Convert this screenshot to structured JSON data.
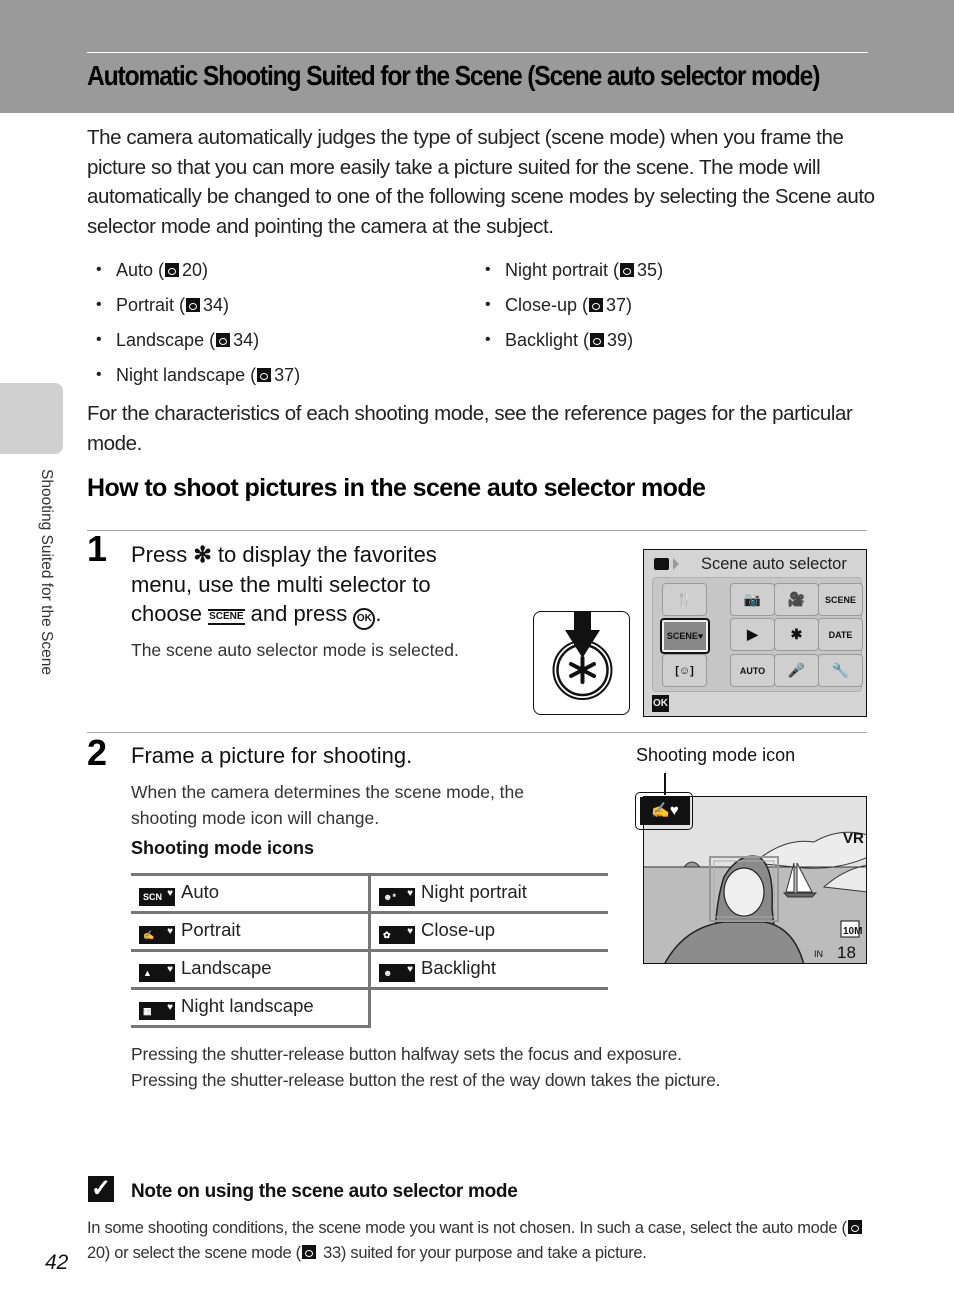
{
  "header": {
    "title": "Automatic Shooting Suited for the Scene (Scene auto selector mode)"
  },
  "intro": "The camera automatically judges the type of subject (scene mode) when you frame the picture so that you can more easily take a picture suited for the scene. The mode will automatically be changed to one of the following scene modes by selecting the Scene auto selector mode and pointing the camera at the subject.",
  "scene_modes_left": [
    {
      "label": "Auto (",
      "page": "20)"
    },
    {
      "label": "Portrait (",
      "page": "34)"
    },
    {
      "label": "Landscape (",
      "page": "34)"
    },
    {
      "label": "Night landscape (",
      "page": "37)"
    }
  ],
  "scene_modes_right": [
    {
      "label": "Night portrait (",
      "page": "35)"
    },
    {
      "label": "Close-up (",
      "page": "37)"
    },
    {
      "label": "Backlight (",
      "page": "39)"
    }
  ],
  "characteristics": "For the characteristics of each shooting mode, see the reference pages for the particular mode.",
  "section_title": "How to shoot pictures in the scene auto selector mode",
  "side_label": "Shooting Suited for the Scene",
  "step1": {
    "number": "1",
    "line1_a": "Press ",
    "line1_sym": "✻",
    "line1_b": " to display the favorites",
    "line2": "menu, use the multi selector to",
    "line3_a": "choose ",
    "line3_icon": "SCENE",
    "line3_b": " and press ",
    "line3_ok": "OK",
    "line3_c": ".",
    "sub": "The scene auto selector mode is selected."
  },
  "lcd": {
    "title": "Scene auto selector",
    "ok": "OK",
    "tiles": [
      "🍴",
      "📷",
      "🎥",
      "SCENE",
      "SCENE♥",
      "▶",
      "✱",
      "DATE",
      "[☺]",
      "AUTO",
      "🎤",
      "🔧"
    ]
  },
  "step2": {
    "number": "2",
    "heading": "Frame a picture for shooting.",
    "sub1": "When the camera determines the scene mode, the",
    "sub2": "shooting mode icon will change.",
    "table_title": "Shooting mode icons"
  },
  "mode_icons": [
    [
      "Auto",
      "Night portrait"
    ],
    [
      "Portrait",
      "Close-up"
    ],
    [
      "Landscape",
      "Backlight"
    ],
    [
      "Night landscape",
      ""
    ]
  ],
  "mode_icon_glyphs": [
    [
      "SCN",
      "☻*"
    ],
    [
      "✍",
      "✿"
    ],
    [
      "▲",
      "☻"
    ],
    [
      "▦",
      ""
    ]
  ],
  "photo": {
    "label": "Shooting mode icon",
    "vr": "VR",
    "size": "10M",
    "memory": "IN",
    "remaining": "18"
  },
  "pressing": {
    "line1": "Pressing the shutter-release button halfway sets the focus and exposure.",
    "line2": "Pressing the shutter-release button the rest of the way down takes the picture."
  },
  "note": {
    "check": "✓",
    "title": "Note on using the scene auto selector mode",
    "body_a": "In some shooting conditions, the scene mode you want is not chosen. In such a case, select the auto mode (",
    "body_b": " 20) or select the scene mode (",
    "body_c": " 33) suited for your purpose and take a picture."
  },
  "page_number": "42"
}
